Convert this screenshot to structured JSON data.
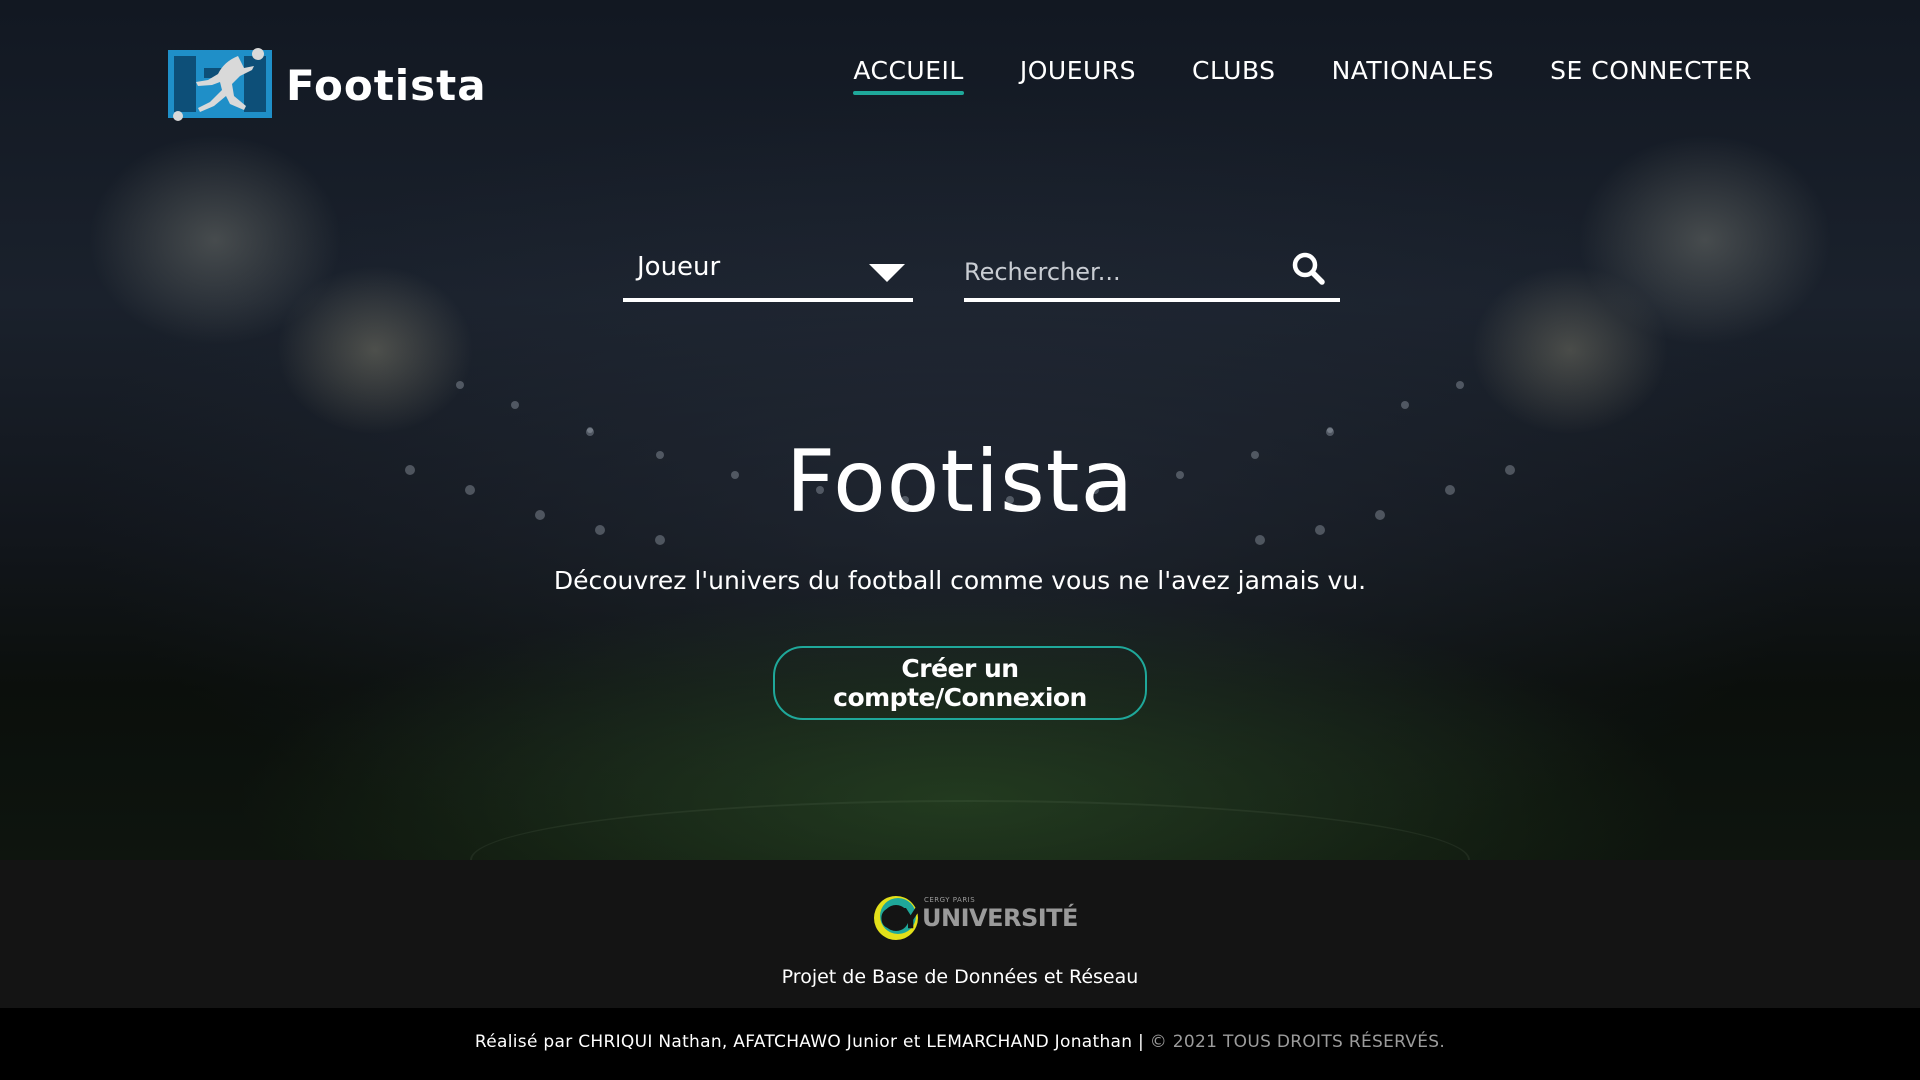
{
  "header": {
    "logo_text": "Footista",
    "nav": [
      {
        "label": "ACCUEIL",
        "active": true
      },
      {
        "label": "JOUEURS",
        "active": false
      },
      {
        "label": "CLUBS",
        "active": false
      },
      {
        "label": "NATIONALES",
        "active": false
      },
      {
        "label": "SE CONNECTER",
        "active": false
      }
    ]
  },
  "search": {
    "category_selected": "Joueur",
    "placeholder": "Rechercher...",
    "icon": "search-icon"
  },
  "hero": {
    "title": "Footista",
    "subtitle": "Découvrez l'univers du football comme vous ne l'avez jamais vu.",
    "cta_label": "Créer un compte/Connexion"
  },
  "footer": {
    "university_small": "CERGY PARIS",
    "university_big": "UNIVERSITÉ",
    "university_initials": "CY",
    "project": "Projet de Base de Données et Réseau",
    "credits": "Réalisé par CHRIQUI Nathan, AFATCHAWO Junior et LEMARCHAND Jonathan |",
    "copyright_symbol": "©",
    "rights": "2021 TOUS DROITS RÉSERVÉS."
  },
  "colors": {
    "accent": "#1fa89a",
    "footer_bg": "#141414",
    "logo_blue": "#1f8fc8"
  }
}
